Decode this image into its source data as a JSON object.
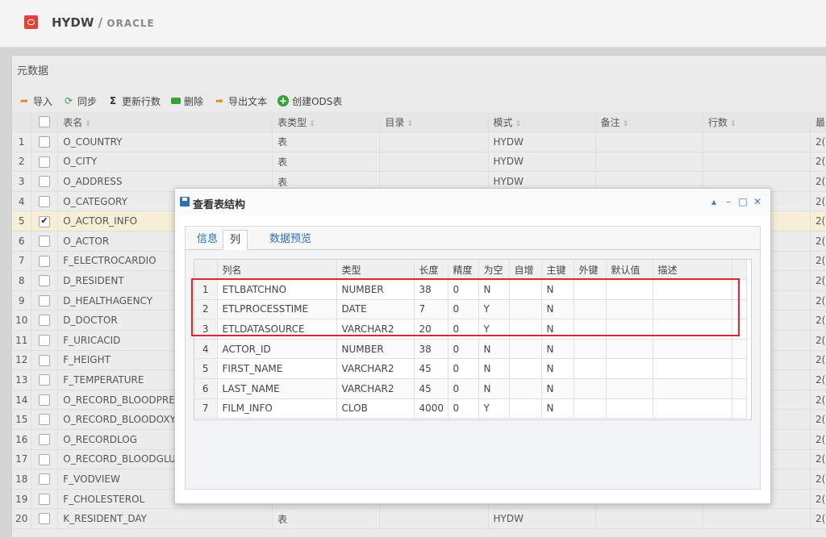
{
  "header": {
    "title": "HYDW",
    "separator": "/",
    "subtitle": "ORACLE"
  },
  "panel": {
    "title": "元数据"
  },
  "toolbar": [
    {
      "label": "导入",
      "icon": "import-icon"
    },
    {
      "label": "同步",
      "icon": "sync-icon"
    },
    {
      "label": "更新行数",
      "icon": "sum-icon"
    },
    {
      "label": "删除",
      "icon": "delete-icon"
    },
    {
      "label": "导出文本",
      "icon": "export-icon"
    },
    {
      "label": "创建ODS表",
      "icon": "add-icon"
    }
  ],
  "grid": {
    "columns": [
      "表名",
      "表类型",
      "目录",
      "模式",
      "备注",
      "行数",
      "最"
    ],
    "rows": [
      {
        "n": "1",
        "name": "O_COUNTRY",
        "type": "表",
        "catalog": "",
        "schema": "HYDW",
        "note": "",
        "rows": "",
        "last": "2(",
        "checked": false
      },
      {
        "n": "2",
        "name": "O_CITY",
        "type": "表",
        "catalog": "",
        "schema": "HYDW",
        "note": "",
        "rows": "",
        "last": "2(",
        "checked": false
      },
      {
        "n": "3",
        "name": "O_ADDRESS",
        "type": "表",
        "catalog": "",
        "schema": "HYDW",
        "note": "",
        "rows": "",
        "last": "2(",
        "checked": false
      },
      {
        "n": "4",
        "name": "O_CATEGORY",
        "type": "",
        "catalog": "",
        "schema": "",
        "note": "",
        "rows": "",
        "last": "2(",
        "checked": false
      },
      {
        "n": "5",
        "name": "O_ACTOR_INFO",
        "type": "",
        "catalog": "",
        "schema": "",
        "note": "",
        "rows": "",
        "last": "2(",
        "checked": true
      },
      {
        "n": "6",
        "name": "O_ACTOR",
        "type": "",
        "catalog": "",
        "schema": "",
        "note": "",
        "rows": "",
        "last": "2(",
        "checked": false
      },
      {
        "n": "7",
        "name": "F_ELECTROCARDIO",
        "type": "",
        "catalog": "",
        "schema": "",
        "note": "",
        "rows": "",
        "last": "2(",
        "checked": false
      },
      {
        "n": "8",
        "name": "D_RESIDENT",
        "type": "",
        "catalog": "",
        "schema": "",
        "note": "",
        "rows": "",
        "last": "2(",
        "checked": false
      },
      {
        "n": "9",
        "name": "D_HEALTHAGENCY",
        "type": "",
        "catalog": "",
        "schema": "",
        "note": "",
        "rows": "",
        "last": "2(",
        "checked": false
      },
      {
        "n": "10",
        "name": "D_DOCTOR",
        "type": "",
        "catalog": "",
        "schema": "",
        "note": "",
        "rows": "",
        "last": "2(",
        "checked": false
      },
      {
        "n": "11",
        "name": "F_URICACID",
        "type": "",
        "catalog": "",
        "schema": "",
        "note": "",
        "rows": "",
        "last": "2(",
        "checked": false
      },
      {
        "n": "12",
        "name": "F_HEIGHT",
        "type": "",
        "catalog": "",
        "schema": "",
        "note": "",
        "rows": "",
        "last": "2(",
        "checked": false
      },
      {
        "n": "13",
        "name": "F_TEMPERATURE",
        "type": "",
        "catalog": "",
        "schema": "",
        "note": "",
        "rows": "",
        "last": "2(",
        "checked": false
      },
      {
        "n": "14",
        "name": "O_RECORD_BLOODPRE",
        "type": "",
        "catalog": "",
        "schema": "",
        "note": "",
        "rows": "",
        "last": "2(",
        "checked": false
      },
      {
        "n": "15",
        "name": "O_RECORD_BLOODOXY",
        "type": "",
        "catalog": "",
        "schema": "",
        "note": "",
        "rows": "",
        "last": "2(",
        "checked": false
      },
      {
        "n": "16",
        "name": "O_RECORDLOG",
        "type": "",
        "catalog": "",
        "schema": "",
        "note": "",
        "rows": "",
        "last": "2(",
        "checked": false
      },
      {
        "n": "17",
        "name": "O_RECORD_BLOODGLU",
        "type": "",
        "catalog": "",
        "schema": "",
        "note": "",
        "rows": "",
        "last": "2(",
        "checked": false
      },
      {
        "n": "18",
        "name": "F_VODVIEW",
        "type": "",
        "catalog": "",
        "schema": "",
        "note": "",
        "rows": "",
        "last": "2(",
        "checked": false
      },
      {
        "n": "19",
        "name": "F_CHOLESTEROL",
        "type": "",
        "catalog": "",
        "schema": "",
        "note": "",
        "rows": "",
        "last": "2(",
        "checked": false
      },
      {
        "n": "20",
        "name": "K_RESIDENT_DAY",
        "type": "表",
        "catalog": "",
        "schema": "HYDW",
        "note": "",
        "rows": "",
        "last": "2(",
        "checked": false
      }
    ]
  },
  "dialog": {
    "title": "查看表结构",
    "controls": [
      "▴",
      "–",
      "□",
      "✕"
    ],
    "tabs": [
      "信息",
      "列",
      "数据预览"
    ],
    "active_tab": 1,
    "columns": [
      "列名",
      "类型",
      "长度",
      "精度",
      "为空",
      "自增",
      "主键",
      "外键",
      "默认值",
      "描述"
    ],
    "rows": [
      {
        "n": "1",
        "name": "ETLBATCHNO",
        "type": "NUMBER",
        "len": "38",
        "prec": "0",
        "null": "N",
        "auto": "",
        "pk": "N",
        "fk": "",
        "def": "",
        "desc": ""
      },
      {
        "n": "2",
        "name": "ETLPROCESSTIME",
        "type": "DATE",
        "len": "7",
        "prec": "0",
        "null": "Y",
        "auto": "",
        "pk": "N",
        "fk": "",
        "def": "",
        "desc": ""
      },
      {
        "n": "3",
        "name": "ETLDATASOURCE",
        "type": "VARCHAR2",
        "len": "20",
        "prec": "0",
        "null": "Y",
        "auto": "",
        "pk": "N",
        "fk": "",
        "def": "",
        "desc": ""
      },
      {
        "n": "4",
        "name": "ACTOR_ID",
        "type": "NUMBER",
        "len": "38",
        "prec": "0",
        "null": "N",
        "auto": "",
        "pk": "N",
        "fk": "",
        "def": "",
        "desc": ""
      },
      {
        "n": "5",
        "name": "FIRST_NAME",
        "type": "VARCHAR2",
        "len": "45",
        "prec": "0",
        "null": "N",
        "auto": "",
        "pk": "N",
        "fk": "",
        "def": "",
        "desc": ""
      },
      {
        "n": "6",
        "name": "LAST_NAME",
        "type": "VARCHAR2",
        "len": "45",
        "prec": "0",
        "null": "N",
        "auto": "",
        "pk": "N",
        "fk": "",
        "def": "",
        "desc": ""
      },
      {
        "n": "7",
        "name": "FILM_INFO",
        "type": "CLOB",
        "len": "4000",
        "prec": "0",
        "null": "Y",
        "auto": "",
        "pk": "N",
        "fk": "",
        "def": "",
        "desc": ""
      }
    ]
  },
  "highlight_color": "#e0262b"
}
